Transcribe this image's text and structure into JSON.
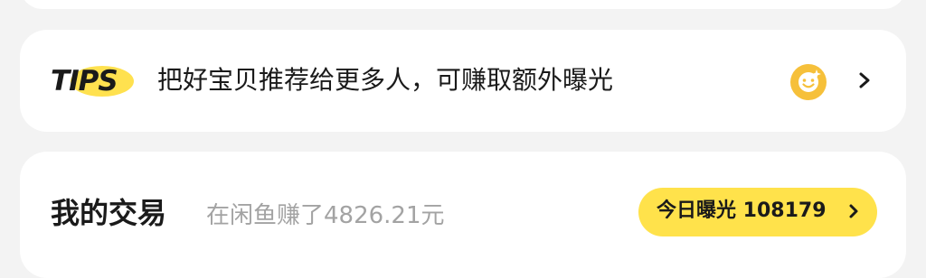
{
  "tips_card": {
    "badge_text": "TIPS",
    "message": "把好宝贝推荐给更多人，可赚取额外曝光",
    "emoji_icon": "smiley-sparkle-icon",
    "chevron_icon": "chevron-right-icon"
  },
  "trade_card": {
    "title": "我的交易",
    "earned_text": "在闲鱼赚了4826.21元",
    "exposure_button": {
      "label": "今日曝光 108179",
      "chevron_icon": "chevron-right-icon"
    }
  },
  "colors": {
    "accent_yellow": "#FFE24B",
    "emoji_orange": "#F6C03A",
    "background": "#F3F3F3",
    "card": "#FFFFFF",
    "text_primary": "#1A1A1A",
    "text_secondary": "#A3A3A3"
  }
}
